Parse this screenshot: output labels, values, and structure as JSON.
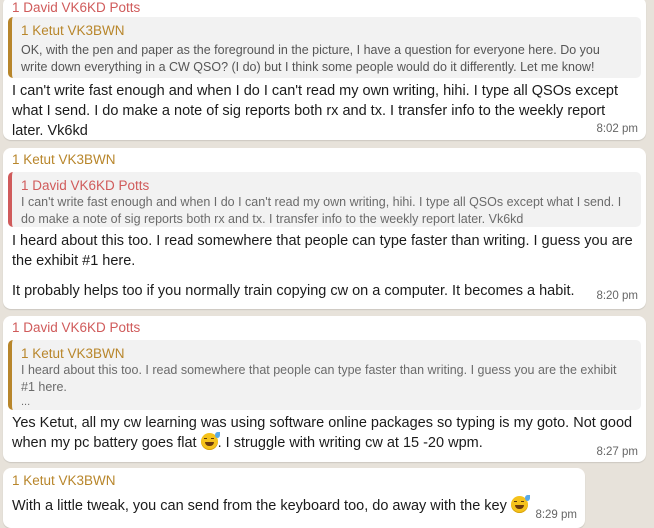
{
  "colors": {
    "background": "#e7e2da",
    "sender_david": "#d05b5b",
    "sender_ketut": "#b8862b",
    "bubble": "#ffffff",
    "quote_bg": "#f2f2f2"
  },
  "messages": [
    {
      "sender": "1 David VK6KD Potts",
      "quote_sender": "1 Ketut VK3BWN",
      "quote_text": "OK, with the pen and paper as the foreground in the picture, I have a question for everyone here. Do you write down everything in a CW QSO? (I do) but I think some people would do it differently. Let me know!",
      "text": "I can't write fast enough and when I do I can't read my own writing, hihi.  I type all QSOs except what I send. I do make a note of sig reports both rx and tx.  I transfer info to the weekly report later. Vk6kd",
      "time": "8:02 pm"
    },
    {
      "sender": "1 Ketut VK3BWN",
      "quote_sender": "1 David VK6KD Potts",
      "quote_text": "I can't write fast enough and when I do I can't read my own writing, hihi.  I type all QSOs except what I send. I do make a note of sig reports both rx and tx.  I transfer info to the weekly report later. Vk6kd",
      "text_1": "I heard about this too. I read somewhere that people can type faster than writing. I guess you are the exhibit #1 here.",
      "text_2": "It probably helps too if you normally train copying cw on a computer. It becomes a habit.",
      "time": "8:20 pm"
    },
    {
      "sender": "1 David VK6KD Potts",
      "quote_sender": "1 Ketut VK3BWN",
      "quote_text": "I heard about this too. I read somewhere that people can type faster than writing. I guess you are the exhibit #1 here.",
      "quote_more": "...",
      "text_a": "Yes Ketut, all my cw learning was using software online packages so typing is my goto.  Not good when my pc battery goes flat",
      "emoji": "grinning-sweat-emoji",
      "text_b": ". I struggle with writing cw at 15 -20 wpm.",
      "time": "8:27 pm"
    },
    {
      "sender": "1 Ketut VK3BWN",
      "text": "With a little tweak, you can send from the keyboard too,  do away with the key",
      "emoji": "grinning-sweat-emoji",
      "time": "8:29 pm"
    }
  ]
}
